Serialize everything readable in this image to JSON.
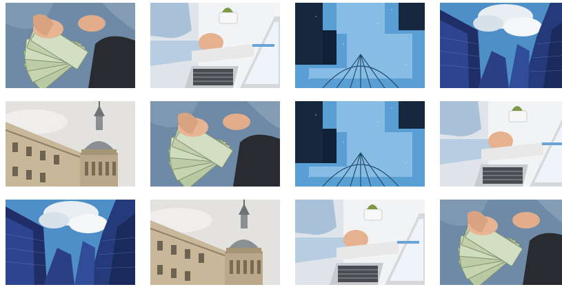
{
  "gallery": {
    "columns": 4,
    "rows": 3,
    "tiles": [
      {
        "subject": "money"
      },
      {
        "subject": "laptop"
      },
      {
        "subject": "umbrella"
      },
      {
        "subject": "skyscrapers"
      },
      {
        "subject": "dome-building"
      },
      {
        "subject": "money"
      },
      {
        "subject": "umbrella"
      },
      {
        "subject": "laptop"
      },
      {
        "subject": "skyscrapers"
      },
      {
        "subject": "dome-building"
      },
      {
        "subject": "laptop"
      },
      {
        "subject": "money"
      }
    ]
  },
  "colors": {
    "background": "#ffffff",
    "denim": "#6f8aa6",
    "skin": "#e8b594",
    "dollar": "#b9c9a4",
    "sky_blue": "#4f8fc8",
    "glass_dark": "#1f2e66",
    "stone": "#c9b79a",
    "reflection": "#5a9fd4"
  }
}
